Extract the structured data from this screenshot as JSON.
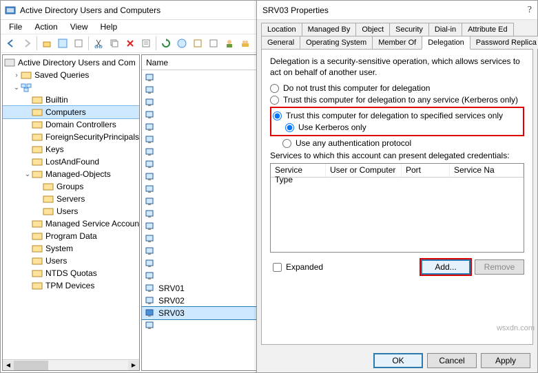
{
  "mmc": {
    "title": "Active Directory Users and Computers",
    "menus": [
      "File",
      "Action",
      "View",
      "Help"
    ]
  },
  "tree": {
    "root": "Active Directory Users and Com",
    "saved": "Saved Queries",
    "nodes": [
      "Builtin",
      "Computers",
      "Domain Controllers",
      "ForeignSecurityPrincipals",
      "Keys",
      "LostAndFound",
      "Managed-Objects"
    ],
    "mo_children": [
      "Groups",
      "Servers",
      "Users"
    ],
    "nodes2": [
      "Managed Service Accoun",
      "NTDS Quotas",
      "Program Data",
      "System",
      "TPM Devices",
      "Users"
    ],
    "nodes2_order": [
      "Managed Service Accoun",
      "Program Data",
      "System",
      "Users",
      "NTDS Quotas",
      "TPM Devices"
    ]
  },
  "list": {
    "header": "Name",
    "items": [
      "SRV01",
      "SRV02",
      "SRV03"
    ],
    "decorative_count": 17,
    "selected": "SRV03"
  },
  "dlg": {
    "title": "SRV03 Properties",
    "help": "?",
    "tabs_row1": [
      "Location",
      "Managed By",
      "Object",
      "Security",
      "Dial-in",
      "Attribute Ed"
    ],
    "tabs_row2": [
      "General",
      "Operating System",
      "Member Of",
      "Delegation",
      "Password Replica"
    ],
    "active_tab": "Delegation",
    "desc": "Delegation is a security-sensitive operation, which allows services to act on behalf of another user.",
    "r1": "Do not trust this computer for delegation",
    "r2": "Trust this computer for delegation to any service (Kerberos only)",
    "r3": "Trust this computer for delegation to specified services only",
    "r3a": "Use Kerberos only",
    "r3b": "Use any authentication protocol",
    "svclabel": "Services to which this account can present delegated credentials:",
    "svccols": [
      "Service Type",
      "User or Computer",
      "Port",
      "Service Na"
    ],
    "expanded": "Expanded",
    "add": "Add...",
    "remove": "Remove",
    "ok": "OK",
    "cancel": "Cancel",
    "apply": "Apply"
  },
  "watermark": "wsxdn.com"
}
